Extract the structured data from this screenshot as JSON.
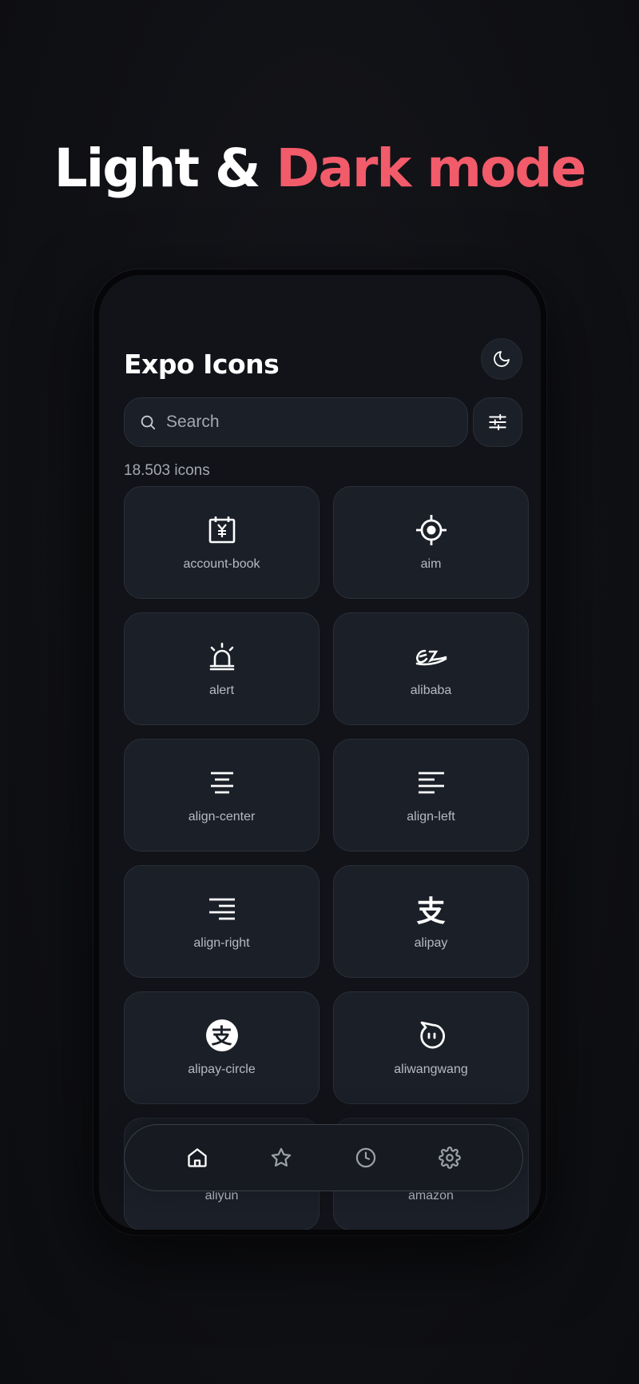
{
  "headline": {
    "part1": "Light & ",
    "part2": "Dark mode"
  },
  "app": {
    "title": "Expo Icons",
    "search": {
      "placeholder": "Search",
      "value": ""
    },
    "count": "18.503 icons"
  },
  "icons": [
    {
      "name": "account-book",
      "icon": "account-book-icon"
    },
    {
      "name": "aim",
      "icon": "aim-icon"
    },
    {
      "name": "alert",
      "icon": "alert-icon"
    },
    {
      "name": "alibaba",
      "icon": "alibaba-icon"
    },
    {
      "name": "align-center",
      "icon": "align-center-icon"
    },
    {
      "name": "align-left",
      "icon": "align-left-icon"
    },
    {
      "name": "align-right",
      "icon": "align-right-icon"
    },
    {
      "name": "alipay",
      "icon": "alipay-icon",
      "glyph": "支"
    },
    {
      "name": "alipay-circle",
      "icon": "alipay-circle-icon",
      "glyph": "支"
    },
    {
      "name": "aliwangwang",
      "icon": "aliwangwang-icon"
    },
    {
      "name": "aliyun",
      "icon": "aliyun-icon"
    },
    {
      "name": "amazon",
      "icon": "amazon-icon"
    }
  ],
  "tabbar": [
    {
      "name": "home",
      "icon": "home-icon",
      "active": true
    },
    {
      "name": "favorites",
      "icon": "star-icon",
      "active": false
    },
    {
      "name": "history",
      "icon": "clock-icon",
      "active": false
    },
    {
      "name": "settings",
      "icon": "gear-icon",
      "active": false
    }
  ],
  "colors": {
    "accent": "#f25b6a",
    "background": "#111318",
    "card": "#1b1f28",
    "muted_text": "#a4a8b0"
  }
}
